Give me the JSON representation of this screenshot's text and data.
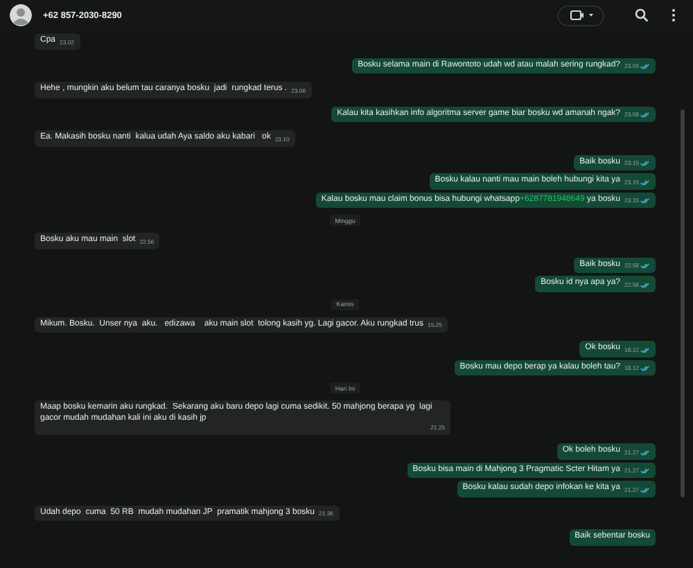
{
  "header": {
    "title": "+62 857-2030-8290"
  },
  "messages": [
    {
      "kind": "in",
      "text": "Cpa",
      "time": "23.02"
    },
    {
      "kind": "out",
      "text": "Bosku selama main di Rawontoto udah wd atau malah sering rungkad?",
      "time": "23.03",
      "read": true
    },
    {
      "kind": "in",
      "text": "Hehe , mungkin aku belum tau caranya bosku  jadi  rungkad terus .",
      "time": "23.06"
    },
    {
      "kind": "out",
      "text": "Kalau kita kasihkan info algoritma server game biar bosku wd amanah ngak?",
      "time": "23.08",
      "read": true
    },
    {
      "kind": "in",
      "text": "Ea. Makasih bosku nanti  kalua udah Aya saldo aku kabari   ok",
      "time": "23.10"
    },
    {
      "kind": "out",
      "text": "Baik bosku",
      "time": "23.15",
      "read": true
    },
    {
      "kind": "out",
      "text": "Bosku kalau nanti mau main boleh hubungi kita ya",
      "time": "23.15",
      "read": true
    },
    {
      "kind": "out",
      "text": "Kalau bosku mau claim bonus bisa hubungi whatsapp",
      "link": "+6287781948649",
      "text_after": "ya bosku",
      "time": "23.15",
      "read": true
    },
    {
      "kind": "date",
      "text": "Minggu"
    },
    {
      "kind": "in",
      "text": "Bosku aku mau main  slot",
      "time": "22.56"
    },
    {
      "kind": "out",
      "text": "Baik bosku",
      "time": "22.58",
      "read": true
    },
    {
      "kind": "out",
      "text": "Bosku id nya apa ya?",
      "time": "22.58",
      "read": true
    },
    {
      "kind": "date",
      "text": "Kamis"
    },
    {
      "kind": "in",
      "text": "Mikum. Bosku.  Unser nya  aku.   edizawa    aku main slot  tolong kasih yg. Lagi gacor. Aku rungkad trus",
      "time": "15.25"
    },
    {
      "kind": "out",
      "text": "Ok bosku",
      "time": "18.12",
      "read": true
    },
    {
      "kind": "out",
      "text": "Bosku mau depo berap ya kalau boleh tau?",
      "time": "18.12",
      "read": true
    },
    {
      "kind": "date",
      "text": "Hari Ini"
    },
    {
      "kind": "in",
      "text": "Maap bosku kemarin aku rungkad.  Sekarang aku baru depo lagi cuma sedikit. 50 mahjong berapa yg  lagi gacor mudah mudahan kali ini aku di kasih jp",
      "time": "21.25"
    },
    {
      "kind": "out",
      "text": "Ok boleh bosku",
      "time": "21.27",
      "read": true
    },
    {
      "kind": "out",
      "text": "Bosku bisa main di Mahjong 3 Pragmatic Scter Hitam ya",
      "time": "21.27",
      "read": true
    },
    {
      "kind": "out",
      "text": "Bosku kalau sudah depo infokan ke kita ya",
      "time": "21.27",
      "read": true
    },
    {
      "kind": "in",
      "text": "Udah depo  cuma  50 RB  mudah mudahan JP  pramatik mahjong 3 bosku",
      "time": "21.36"
    },
    {
      "kind": "out",
      "text": "Baik sebentar bosku"
    }
  ]
}
